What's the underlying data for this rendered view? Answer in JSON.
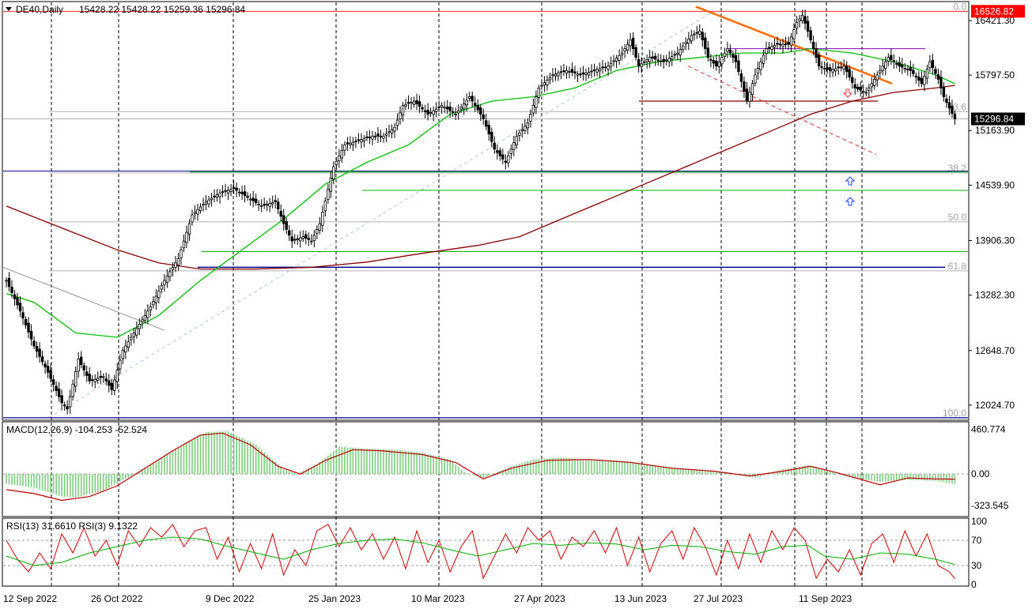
{
  "chart_data": {
    "type": "candlestick",
    "header": {
      "symbol_tf": "DE40,Daily",
      "ohlc": "15428.22 15428.22 15259.36 15296.84"
    },
    "price_axis": {
      "ticks": [
        "16421.30",
        "15797.50",
        "15163.90",
        "14539.90",
        "13906.30",
        "13282.30",
        "12648.70",
        "12024.70"
      ],
      "tick_values": [
        16421.3,
        15797.5,
        15163.9,
        14539.9,
        13906.3,
        13282.3,
        12648.7,
        12024.7
      ],
      "range": [
        11870,
        16620
      ]
    },
    "price_labels": {
      "resistance": "16526.82",
      "resistance_value": 16526.82,
      "resistance_color": "#ff0000",
      "current": "15296.84",
      "current_value": 15296.84
    },
    "fib_levels": [
      {
        "label": "0.0",
        "value": 16526.82
      },
      {
        "label": "23.6",
        "value": 15380
      },
      {
        "label": "38.2",
        "value": 14680
      },
      {
        "label": "50.0",
        "value": 14120
      },
      {
        "label": "61.8",
        "value": 13560
      },
      {
        "label": "100.0",
        "value": 11880
      }
    ],
    "dates": [
      "12 Sep 2022",
      "26 Oct 2022",
      "9 Dec 2022",
      "25 Jan 2023",
      "10 Mar 2023",
      "27 Apr 2023",
      "13 Jun 2023",
      "27 Jul 2023",
      "11 Sep 2023"
    ],
    "close_path": [
      [
        0,
        13450
      ],
      [
        5,
        13100
      ],
      [
        10,
        12700
      ],
      [
        15,
        12400
      ],
      [
        20,
        12050
      ],
      [
        22,
        11980
      ],
      [
        26,
        12550
      ],
      [
        30,
        12300
      ],
      [
        35,
        12350
      ],
      [
        38,
        12200
      ],
      [
        42,
        12650
      ],
      [
        47,
        12900
      ],
      [
        52,
        13150
      ],
      [
        57,
        13450
      ],
      [
        62,
        13700
      ],
      [
        67,
        14200
      ],
      [
        72,
        14350
      ],
      [
        77,
        14450
      ],
      [
        82,
        14500
      ],
      [
        87,
        14400
      ],
      [
        92,
        14300
      ],
      [
        97,
        14350
      ],
      [
        100,
        14100
      ],
      [
        103,
        13900
      ],
      [
        107,
        13950
      ],
      [
        110,
        13900
      ],
      [
        113,
        14100
      ],
      [
        118,
        14750
      ],
      [
        122,
        15000
      ],
      [
        127,
        15050
      ],
      [
        132,
        15100
      ],
      [
        136,
        15100
      ],
      [
        140,
        15200
      ],
      [
        143,
        15450
      ],
      [
        147,
        15500
      ],
      [
        152,
        15350
      ],
      [
        157,
        15450
      ],
      [
        162,
        15350
      ],
      [
        167,
        15550
      ],
      [
        172,
        15300
      ],
      [
        176,
        14950
      ],
      [
        180,
        14800
      ],
      [
        184,
        15100
      ],
      [
        188,
        15250
      ],
      [
        192,
        15650
      ],
      [
        197,
        15800
      ],
      [
        202,
        15850
      ],
      [
        207,
        15800
      ],
      [
        212,
        15850
      ],
      [
        217,
        15900
      ],
      [
        222,
        16050
      ],
      [
        225,
        16200
      ],
      [
        228,
        15900
      ],
      [
        232,
        16000
      ],
      [
        237,
        15950
      ],
      [
        242,
        16050
      ],
      [
        247,
        16250
      ],
      [
        250,
        16300
      ],
      [
        253,
        16000
      ],
      [
        256,
        15900
      ],
      [
        260,
        16100
      ],
      [
        263,
        15950
      ],
      [
        267,
        15500
      ],
      [
        270,
        15800
      ],
      [
        274,
        16100
      ],
      [
        278,
        16150
      ],
      [
        282,
        16150
      ],
      [
        285,
        16400
      ],
      [
        287,
        16480
      ],
      [
        289,
        16300
      ],
      [
        293,
        15900
      ],
      [
        297,
        15850
      ],
      [
        302,
        15900
      ],
      [
        306,
        15650
      ],
      [
        310,
        15600
      ],
      [
        314,
        15800
      ],
      [
        318,
        16000
      ],
      [
        322,
        15900
      ],
      [
        326,
        15850
      ],
      [
        330,
        15700
      ],
      [
        333,
        15950
      ],
      [
        336,
        15750
      ],
      [
        338,
        15550
      ],
      [
        340,
        15420
      ],
      [
        342,
        15296.84
      ]
    ],
    "ma_green": [
      [
        0,
        13300
      ],
      [
        10,
        13200
      ],
      [
        25,
        12850
      ],
      [
        40,
        12800
      ],
      [
        55,
        13050
      ],
      [
        70,
        13450
      ],
      [
        85,
        13800
      ],
      [
        100,
        14150
      ],
      [
        115,
        14550
      ],
      [
        130,
        14800
      ],
      [
        145,
        15000
      ],
      [
        160,
        15350
      ],
      [
        175,
        15500
      ],
      [
        190,
        15550
      ],
      [
        205,
        15650
      ],
      [
        220,
        15850
      ],
      [
        235,
        15950
      ],
      [
        250,
        16000
      ],
      [
        265,
        16050
      ],
      [
        280,
        16050
      ],
      [
        290,
        16100
      ],
      [
        305,
        16050
      ],
      [
        320,
        15950
      ],
      [
        335,
        15800
      ],
      [
        342,
        15700
      ]
    ],
    "ma_red": [
      [
        0,
        14300
      ],
      [
        20,
        14050
      ],
      [
        40,
        13800
      ],
      [
        55,
        13650
      ],
      [
        70,
        13580
      ],
      [
        90,
        13580
      ],
      [
        110,
        13600
      ],
      [
        130,
        13660
      ],
      [
        150,
        13760
      ],
      [
        170,
        13850
      ],
      [
        185,
        13950
      ],
      [
        200,
        14150
      ],
      [
        215,
        14350
      ],
      [
        230,
        14550
      ],
      [
        245,
        14750
      ],
      [
        260,
        14950
      ],
      [
        275,
        15150
      ],
      [
        290,
        15350
      ],
      [
        305,
        15500
      ],
      [
        320,
        15600
      ],
      [
        335,
        15650
      ],
      [
        342,
        15680
      ]
    ],
    "macd": {
      "label": "MACD(12,26,9) -104.253 -52.524",
      "ticks": [
        "460.774",
        "0.00",
        "-323.545"
      ],
      "tick_values": [
        460.774,
        0,
        -323.545
      ],
      "range": [
        -420,
        520
      ],
      "hist": [
        [
          0,
          -100
        ],
        [
          10,
          -140
        ],
        [
          20,
          -230
        ],
        [
          25,
          -240
        ],
        [
          35,
          -170
        ],
        [
          45,
          -20
        ],
        [
          55,
          150
        ],
        [
          65,
          320
        ],
        [
          72,
          430
        ],
        [
          80,
          440
        ],
        [
          90,
          300
        ],
        [
          100,
          50
        ],
        [
          105,
          5
        ],
        [
          112,
          100
        ],
        [
          120,
          280
        ],
        [
          130,
          260
        ],
        [
          140,
          250
        ],
        [
          150,
          220
        ],
        [
          160,
          150
        ],
        [
          165,
          20
        ],
        [
          172,
          -40
        ],
        [
          180,
          60
        ],
        [
          190,
          150
        ],
        [
          200,
          170
        ],
        [
          210,
          150
        ],
        [
          220,
          140
        ],
        [
          230,
          100
        ],
        [
          240,
          70
        ],
        [
          250,
          40
        ],
        [
          260,
          20
        ],
        [
          270,
          -40
        ],
        [
          280,
          50
        ],
        [
          289,
          90
        ],
        [
          295,
          40
        ],
        [
          305,
          -40
        ],
        [
          315,
          -80
        ],
        [
          325,
          -60
        ],
        [
          335,
          -70
        ],
        [
          342,
          -104
        ]
      ],
      "signal": [
        [
          0,
          -160
        ],
        [
          10,
          -200
        ],
        [
          20,
          -270
        ],
        [
          30,
          -230
        ],
        [
          40,
          -120
        ],
        [
          50,
          60
        ],
        [
          60,
          240
        ],
        [
          70,
          400
        ],
        [
          78,
          420
        ],
        [
          88,
          300
        ],
        [
          98,
          80
        ],
        [
          106,
          0
        ],
        [
          115,
          140
        ],
        [
          125,
          250
        ],
        [
          135,
          240
        ],
        [
          150,
          200
        ],
        [
          162,
          120
        ],
        [
          172,
          -50
        ],
        [
          182,
          60
        ],
        [
          195,
          140
        ],
        [
          210,
          150
        ],
        [
          225,
          120
        ],
        [
          240,
          60
        ],
        [
          255,
          30
        ],
        [
          268,
          -20
        ],
        [
          280,
          30
        ],
        [
          290,
          80
        ],
        [
          300,
          10
        ],
        [
          315,
          -110
        ],
        [
          325,
          -40
        ],
        [
          335,
          -50
        ],
        [
          342,
          -52.5
        ]
      ]
    },
    "rsi": {
      "label": "RSI(13) 31.6610  RSI(3) 9.1322",
      "ticks": [
        "100",
        "70",
        "30",
        "0"
      ],
      "tick_values": [
        100,
        70,
        30,
        0
      ],
      "levels": [
        70,
        30
      ],
      "rsi13": [
        [
          0,
          45
        ],
        [
          10,
          30
        ],
        [
          20,
          35
        ],
        [
          30,
          50
        ],
        [
          40,
          60
        ],
        [
          50,
          70
        ],
        [
          60,
          75
        ],
        [
          70,
          72
        ],
        [
          80,
          60
        ],
        [
          90,
          50
        ],
        [
          100,
          40
        ],
        [
          110,
          55
        ],
        [
          120,
          65
        ],
        [
          130,
          70
        ],
        [
          140,
          72
        ],
        [
          150,
          66
        ],
        [
          160,
          55
        ],
        [
          170,
          45
        ],
        [
          180,
          55
        ],
        [
          190,
          65
        ],
        [
          200,
          62
        ],
        [
          210,
          66
        ],
        [
          220,
          64
        ],
        [
          230,
          55
        ],
        [
          240,
          62
        ],
        [
          250,
          60
        ],
        [
          260,
          52
        ],
        [
          270,
          48
        ],
        [
          280,
          60
        ],
        [
          289,
          62
        ],
        [
          295,
          45
        ],
        [
          305,
          40
        ],
        [
          315,
          50
        ],
        [
          325,
          48
        ],
        [
          335,
          40
        ],
        [
          342,
          31.66
        ]
      ],
      "rsi3": [
        [
          0,
          70
        ],
        [
          4,
          40
        ],
        [
          8,
          20
        ],
        [
          12,
          50
        ],
        [
          16,
          25
        ],
        [
          20,
          80
        ],
        [
          24,
          50
        ],
        [
          28,
          90
        ],
        [
          32,
          45
        ],
        [
          36,
          70
        ],
        [
          40,
          30
        ],
        [
          44,
          85
        ],
        [
          48,
          60
        ],
        [
          52,
          90
        ],
        [
          56,
          75
        ],
        [
          60,
          95
        ],
        [
          64,
          60
        ],
        [
          68,
          85
        ],
        [
          72,
          90
        ],
        [
          76,
          40
        ],
        [
          80,
          75
        ],
        [
          84,
          20
        ],
        [
          88,
          65
        ],
        [
          92,
          25
        ],
        [
          96,
          80
        ],
        [
          100,
          15
        ],
        [
          104,
          55
        ],
        [
          108,
          30
        ],
        [
          112,
          85
        ],
        [
          116,
          95
        ],
        [
          120,
          60
        ],
        [
          124,
          90
        ],
        [
          128,
          55
        ],
        [
          132,
          80
        ],
        [
          136,
          40
        ],
        [
          140,
          75
        ],
        [
          144,
          25
        ],
        [
          148,
          85
        ],
        [
          152,
          35
        ],
        [
          156,
          70
        ],
        [
          160,
          20
        ],
        [
          164,
          60
        ],
        [
          168,
          85
        ],
        [
          172,
          10
        ],
        [
          176,
          45
        ],
        [
          180,
          80
        ],
        [
          184,
          50
        ],
        [
          188,
          90
        ],
        [
          192,
          70
        ],
        [
          196,
          85
        ],
        [
          200,
          40
        ],
        [
          204,
          75
        ],
        [
          208,
          60
        ],
        [
          212,
          85
        ],
        [
          216,
          50
        ],
        [
          220,
          90
        ],
        [
          224,
          30
        ],
        [
          228,
          75
        ],
        [
          232,
          20
        ],
        [
          236,
          65
        ],
        [
          240,
          85
        ],
        [
          244,
          40
        ],
        [
          248,
          90
        ],
        [
          252,
          60
        ],
        [
          256,
          15
        ],
        [
          260,
          70
        ],
        [
          264,
          25
        ],
        [
          268,
          80
        ],
        [
          272,
          35
        ],
        [
          276,
          85
        ],
        [
          280,
          55
        ],
        [
          284,
          90
        ],
        [
          288,
          70
        ],
        [
          292,
          10
        ],
        [
          296,
          40
        ],
        [
          300,
          20
        ],
        [
          304,
          55
        ],
        [
          308,
          15
        ],
        [
          312,
          65
        ],
        [
          316,
          80
        ],
        [
          320,
          35
        ],
        [
          324,
          85
        ],
        [
          328,
          45
        ],
        [
          332,
          80
        ],
        [
          336,
          30
        ],
        [
          340,
          20
        ],
        [
          342,
          9.13
        ]
      ]
    },
    "colors": {
      "candle": "#000000",
      "ma_green": "#00c000",
      "ma_red": "#8b0000",
      "macd_hist": "#7ccd7c",
      "macd_signal": "#c00000",
      "rsi13": "#00b000",
      "rsi3": "#d00000",
      "trend": "#ff6a00",
      "support_blue": "#00008b",
      "hline_green": "#00b000",
      "hline_purple": "#8000c0",
      "arrow_up": "#1e40ff",
      "arrow_down": "#ff3030"
    }
  }
}
